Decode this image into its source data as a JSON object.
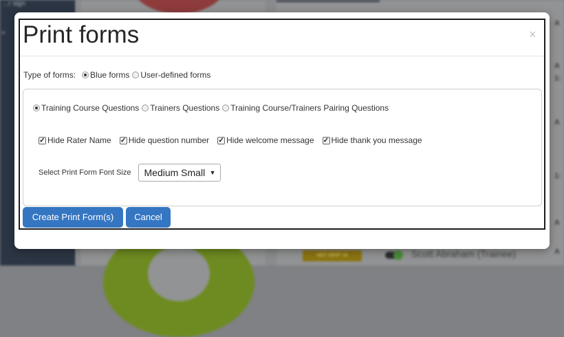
{
  "background": {
    "sidebar_text": "...r sign",
    "sidebar_glyph": "«",
    "badge_text": "NOT SENT 16",
    "trainee_name": "Scott Abraham (Trainee)",
    "right_marks": [
      "A",
      "A",
      "1:",
      "A",
      "1:",
      "A",
      "A"
    ]
  },
  "modal": {
    "title": "Print forms",
    "close_glyph": "×",
    "form_type": {
      "label": "Type of forms:",
      "options": [
        {
          "label": "Blue forms",
          "checked": true
        },
        {
          "label": "User-defined forms",
          "checked": false
        }
      ]
    },
    "question_types": [
      {
        "label": "Training Course Questions",
        "checked": true
      },
      {
        "label": "Trainers Questions",
        "checked": false
      },
      {
        "label": "Training Course/Trainers Pairing Questions",
        "checked": false
      }
    ],
    "hide_options": [
      {
        "label": "Hide Rater Name",
        "checked": true
      },
      {
        "label": "Hide question number",
        "checked": true
      },
      {
        "label": "Hide welcome message",
        "checked": true
      },
      {
        "label": "Hide thank you message",
        "checked": true
      }
    ],
    "font_size": {
      "label": "Select Print Form Font Size",
      "selected": "Medium Small"
    },
    "buttons": {
      "create": "Create Print Form(s)",
      "cancel": "Cancel"
    }
  },
  "colors": {
    "primary_button": "#3576c2",
    "overlay": "#8a8b8d",
    "sidebar": "#2c3544"
  }
}
